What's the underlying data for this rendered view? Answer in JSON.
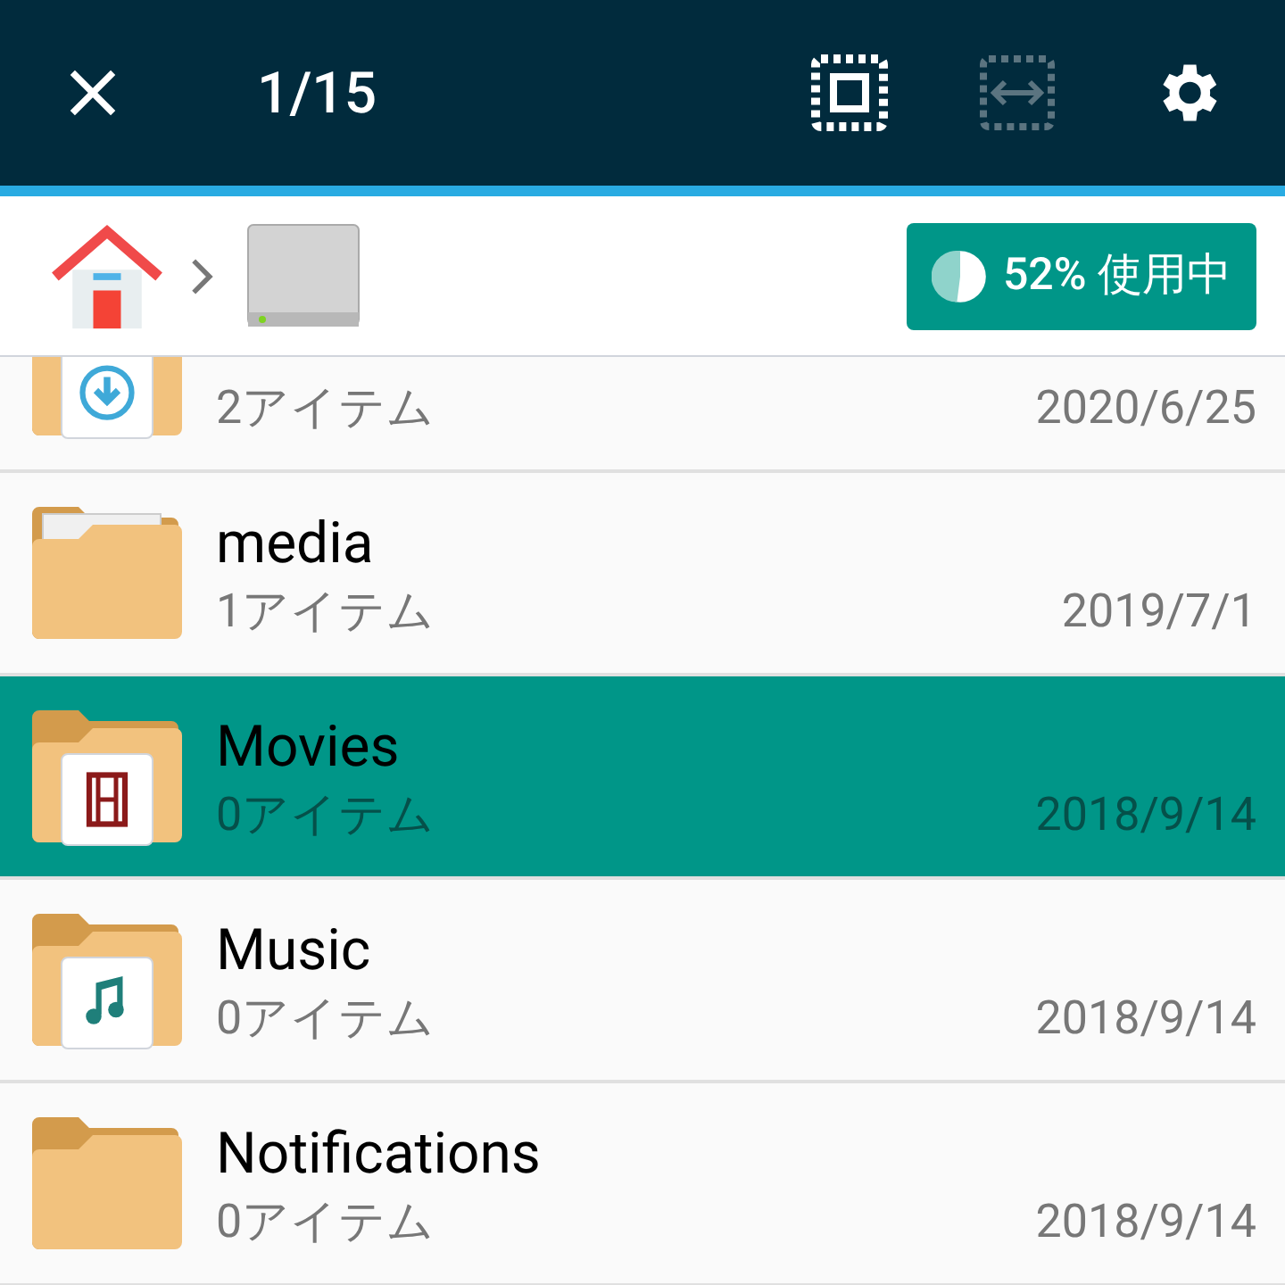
{
  "toolbar": {
    "counter": "1/15"
  },
  "breadcrumb": {
    "storage_badge": {
      "label": "52% 使用中"
    }
  },
  "files": [
    {
      "kind": "download",
      "count": "2アイテム",
      "date": "2020/6/25",
      "selected": false
    },
    {
      "kind": "papers",
      "name": "media",
      "count": "1アイテム",
      "date": "2019/7/1",
      "selected": false
    },
    {
      "kind": "film",
      "name": "Movies",
      "count": "0アイテム",
      "date": "2018/9/14",
      "selected": true
    },
    {
      "kind": "music",
      "name": "Music",
      "count": "0アイテム",
      "date": "2018/9/14",
      "selected": false
    },
    {
      "kind": "plain",
      "name": "Notifications",
      "count": "0アイテム",
      "date": "2018/9/14",
      "selected": false
    }
  ]
}
